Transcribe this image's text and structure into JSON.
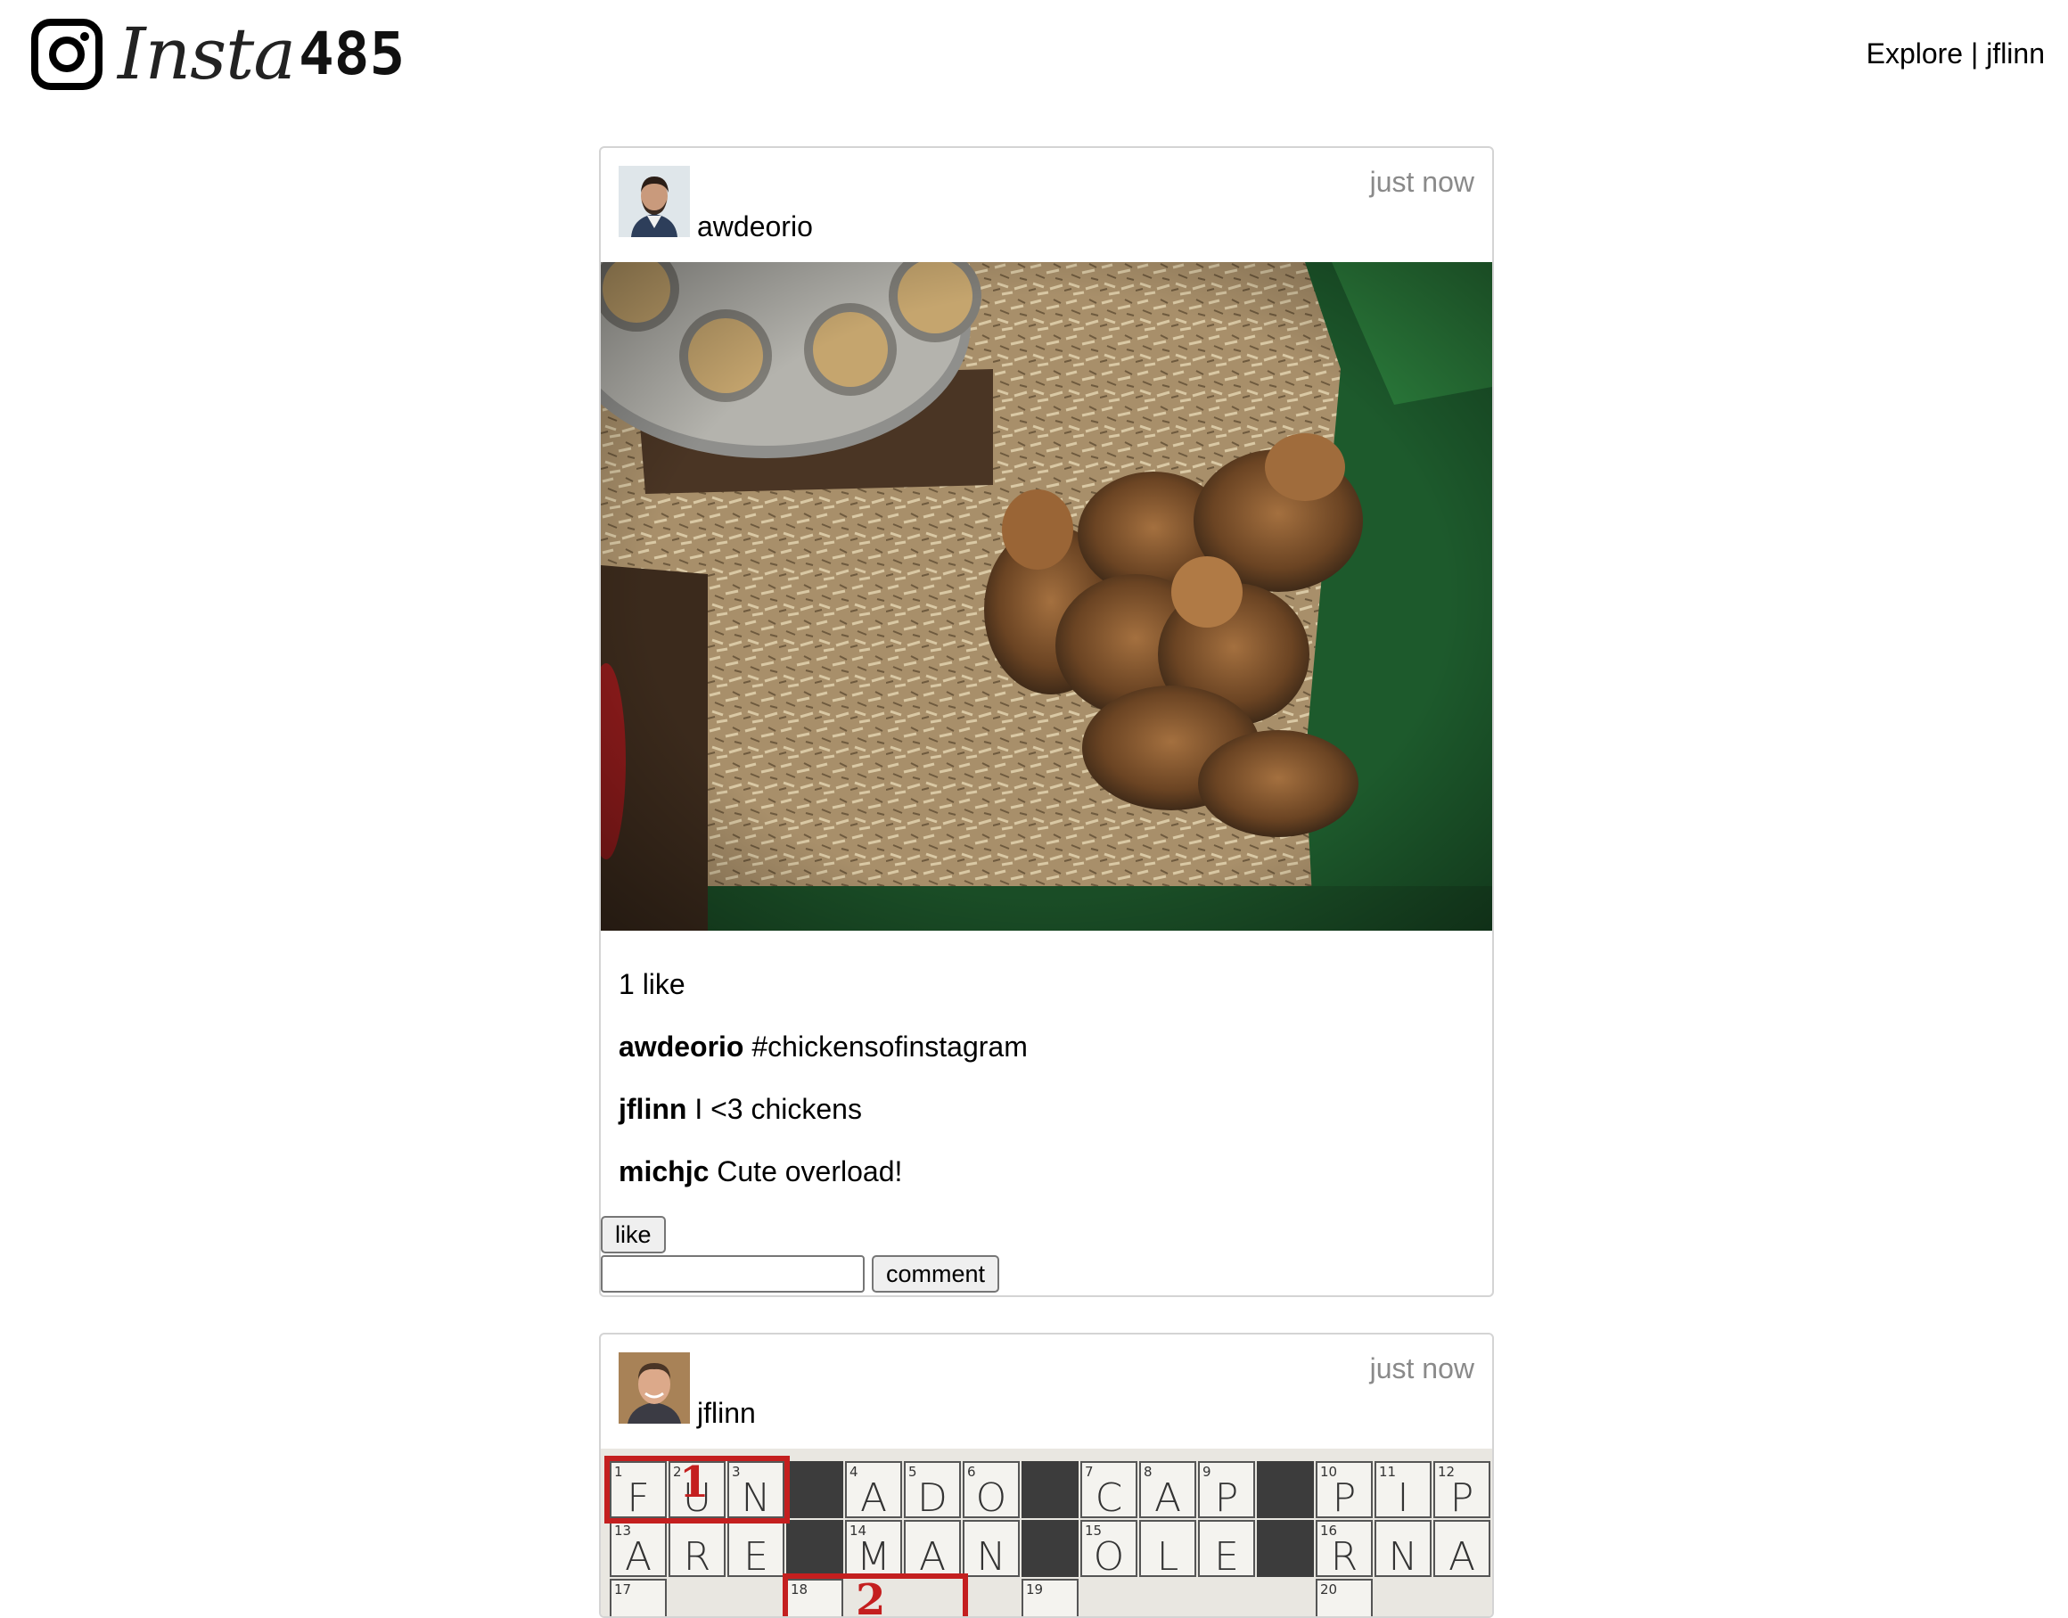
{
  "header": {
    "logo_script": "Insta",
    "logo_number": "485",
    "nav_explore": "Explore",
    "nav_separator": " | ",
    "nav_user": "jflinn"
  },
  "posts": [
    {
      "owner": "awdeorio",
      "timestamp": "just now",
      "likes_text": "1 like",
      "comments": [
        {
          "owner": "awdeorio",
          "text": "#chickensofinstagram"
        },
        {
          "owner": "jflinn",
          "text": "I <3 chickens"
        },
        {
          "owner": "michjc",
          "text": "Cute overload!"
        }
      ],
      "like_button": "like",
      "comment_input_value": "",
      "comment_button": "comment"
    },
    {
      "owner": "jflinn",
      "timestamp": "just now",
      "crossword": {
        "row1": [
          {
            "num": "1",
            "letter": "F"
          },
          {
            "num": "2",
            "letter": "U"
          },
          {
            "num": "3",
            "letter": "N"
          },
          {
            "dark": true
          },
          {
            "num": "4",
            "letter": "A"
          },
          {
            "num": "5",
            "letter": "D"
          },
          {
            "num": "6",
            "letter": "O"
          },
          {
            "dark": true
          },
          {
            "num": "7",
            "letter": "C"
          },
          {
            "num": "8",
            "letter": "A"
          },
          {
            "num": "9",
            "letter": "P"
          },
          {
            "dark": true
          },
          {
            "num": "10",
            "letter": "P"
          },
          {
            "num": "11",
            "letter": "I"
          },
          {
            "num": "12",
            "letter": "P"
          }
        ],
        "row2": [
          {
            "num": "13",
            "letter": "A"
          },
          {
            "num": "",
            "letter": "R"
          },
          {
            "num": "",
            "letter": "E"
          },
          {
            "dark": true
          },
          {
            "num": "14",
            "letter": "M"
          },
          {
            "num": "",
            "letter": "A"
          },
          {
            "num": "",
            "letter": "N"
          },
          {
            "dark": true
          },
          {
            "num": "15",
            "letter": "O"
          },
          {
            "num": "",
            "letter": "L"
          },
          {
            "num": "",
            "letter": "E"
          },
          {
            "dark": true
          },
          {
            "num": "16",
            "letter": "R"
          },
          {
            "num": "",
            "letter": "N"
          },
          {
            "num": "",
            "letter": "A"
          }
        ],
        "row3_numbers": [
          "17",
          "18",
          "19",
          "20"
        ],
        "mark_1": "1",
        "mark_2": "2",
        "accent_color": "#c41f1f"
      }
    }
  ]
}
